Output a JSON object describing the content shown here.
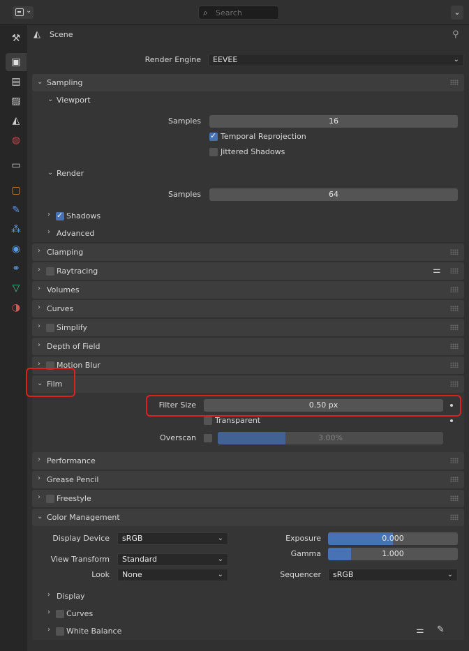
{
  "header": {
    "search_placeholder": "Search"
  },
  "scene": {
    "title": "Scene"
  },
  "render_engine": {
    "label": "Render Engine",
    "value": "EEVEE"
  },
  "sampling": {
    "title": "Sampling",
    "viewport": {
      "title": "Viewport",
      "samples_label": "Samples",
      "samples_value": "16",
      "temporal_label": "Temporal Reprojection",
      "temporal_checked": true,
      "jittered_label": "Jittered Shadows",
      "jittered_checked": false
    },
    "render": {
      "title": "Render",
      "samples_label": "Samples",
      "samples_value": "64"
    },
    "shadows": {
      "title": "Shadows",
      "checked": true
    },
    "advanced": {
      "title": "Advanced"
    }
  },
  "panels": {
    "clamping": "Clamping",
    "raytracing": "Raytracing",
    "volumes": "Volumes",
    "curves": "Curves",
    "simplify": "Simplify",
    "depth_of_field": "Depth of Field",
    "motion_blur": "Motion Blur",
    "performance": "Performance",
    "grease_pencil": "Grease Pencil",
    "freestyle": "Freestyle"
  },
  "film": {
    "title": "Film",
    "filter_size_label": "Filter Size",
    "filter_size_value": "0.50 px",
    "transparent_label": "Transparent",
    "overscan_label": "Overscan",
    "overscan_value": "3.00%",
    "overscan_fraction": 0.3
  },
  "color_management": {
    "title": "Color Management",
    "display_device_label": "Display Device",
    "display_device_value": "sRGB",
    "view_transform_label": "View Transform",
    "view_transform_value": "Standard",
    "look_label": "Look",
    "look_value": "None",
    "exposure_label": "Exposure",
    "exposure_value": "0.000",
    "exposure_fraction": 0.5,
    "gamma_label": "Gamma",
    "gamma_value": "1.000",
    "gamma_fraction": 0.18,
    "sequencer_label": "Sequencer",
    "sequencer_value": "sRGB",
    "display_sub": "Display",
    "curves_sub": "Curves",
    "white_balance_sub": "White Balance"
  },
  "colors": {
    "accent": "#4772b3",
    "highlight": "#e01f1f"
  }
}
